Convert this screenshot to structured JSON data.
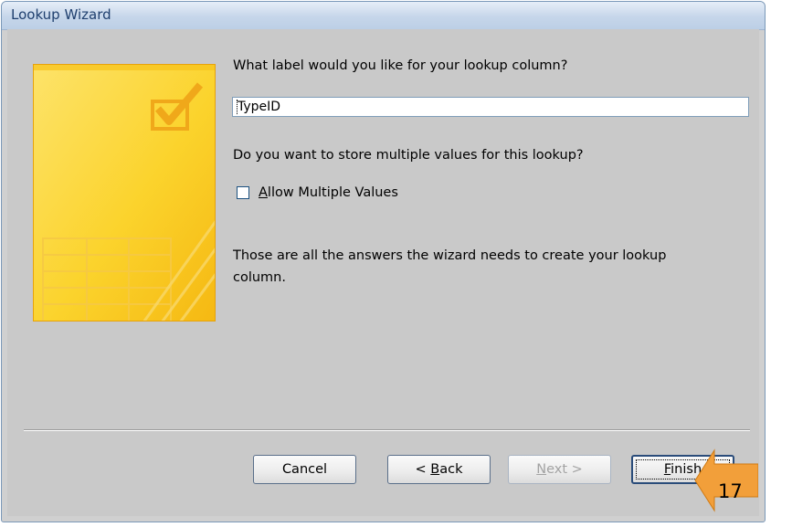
{
  "window": {
    "title": "Lookup Wizard"
  },
  "prompts": {
    "label_question": "What label would you like for your lookup column?",
    "label_value": "TypeID",
    "multi_question": "Do you want to store multiple values for this lookup?",
    "allow_multiple_label": "Allow Multiple Values",
    "allow_multiple_checked": false,
    "done_line1": "Those are all the answers the wizard needs to create your lookup",
    "done_line2": "column."
  },
  "buttons": {
    "cancel": "Cancel",
    "back": "< Back",
    "next": "Next >",
    "finish": "Finish"
  },
  "step_callout": {
    "number": "17"
  },
  "colors": {
    "accent_orange": "#f29f3a",
    "art_yellow": "#fbd32c"
  }
}
